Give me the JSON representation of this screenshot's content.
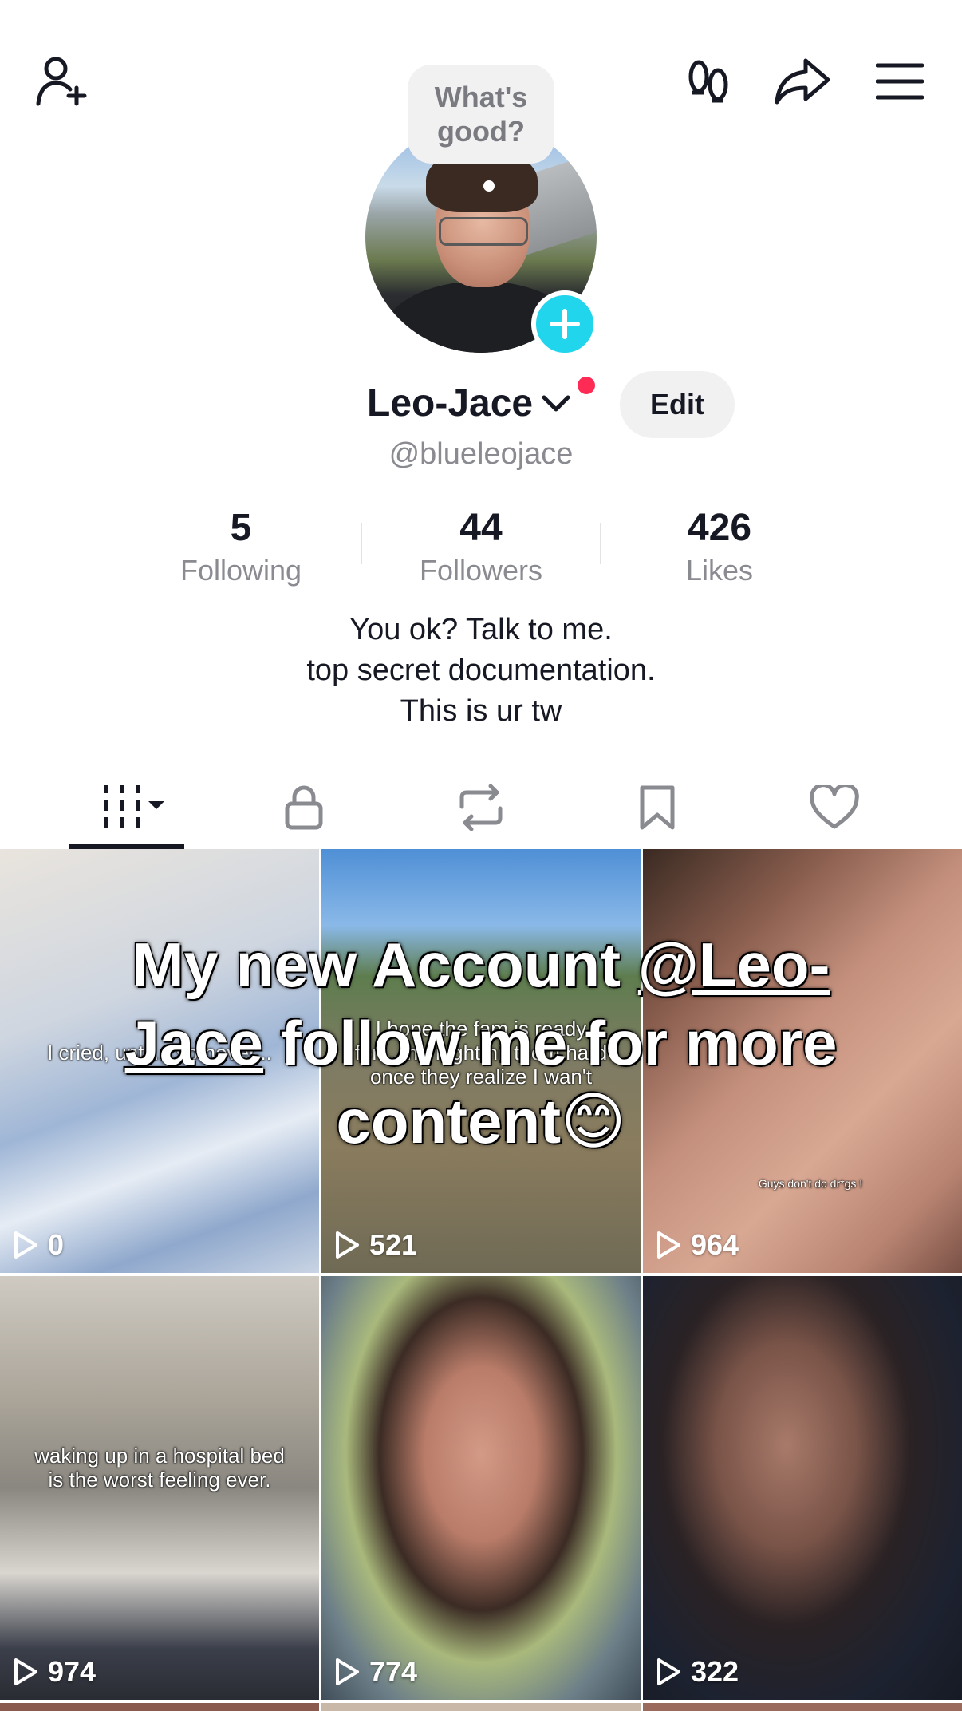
{
  "header": {
    "icons": [
      "add-friend-icon",
      "footprint-icon",
      "share-icon",
      "menu-icon"
    ]
  },
  "profile": {
    "status_bubble": "What's good?",
    "display_name": "Leo-Jace",
    "handle": "@blueleojace",
    "edit_label": "Edit"
  },
  "stats": [
    {
      "value": "5",
      "label": "Following"
    },
    {
      "value": "44",
      "label": "Followers"
    },
    {
      "value": "426",
      "label": "Likes"
    }
  ],
  "bio": {
    "line1": "You ok? Talk to me.",
    "line2": "top secret documentation.",
    "line3": "This is ur tw"
  },
  "tabs": [
    "videos-grid-icon",
    "lock-icon",
    "repost-icon",
    "bookmark-icon",
    "heart-icon"
  ],
  "overlay": {
    "line_prefix": "My new Account ",
    "mention": "@Leo-Jace",
    "line_suffix": " follow me for more content",
    "emoji": "😊"
  },
  "videos": [
    {
      "views": "0",
      "caption": "I cried, until... so never..."
    },
    {
      "views": "521",
      "caption": "I hope the fam is ready for... the night hit them hard once they realize I wan't"
    },
    {
      "views": "964",
      "caption": "Guys don't do dr*gs !"
    },
    {
      "views": "974",
      "caption": "waking up in a hospital bed is the worst feeling ever."
    },
    {
      "views": "774",
      "caption": ""
    },
    {
      "views": "322",
      "caption": ""
    }
  ]
}
